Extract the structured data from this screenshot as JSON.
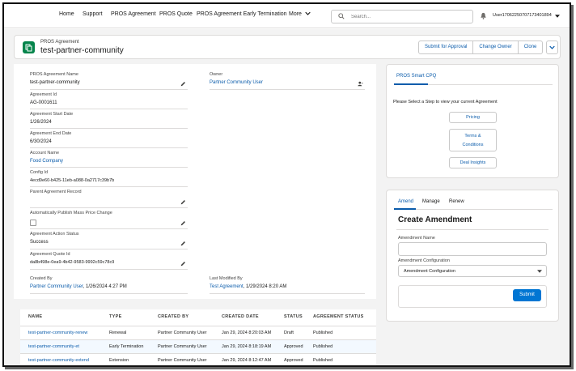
{
  "nav": {
    "items": [
      "Home",
      "Support",
      "PROS Agreement",
      "PROS Quote",
      "PROS Agreement Early Termination"
    ],
    "more_label": "More",
    "search_placeholder": "Search...",
    "user_name": "User17062250707173401894"
  },
  "header": {
    "object_type": "PROS Agreement",
    "record_name": "test-partner-community",
    "buttons": [
      "Submit for Approval",
      "Change Owner",
      "Clone"
    ]
  },
  "details": {
    "agreement_name": {
      "label": "PROS Agreement Name",
      "value": "test-partner-community"
    },
    "owner": {
      "label": "Owner",
      "value": "Partner Community User"
    },
    "agreement_id": {
      "label": "Agreement Id",
      "value": "AG-0001611"
    },
    "start_date": {
      "label": "Agreement Start Date",
      "value": "1/26/2024"
    },
    "end_date": {
      "label": "Agreement End Date",
      "value": "6/30/2024"
    },
    "account_name": {
      "label": "Account Name",
      "value": "Food Company"
    },
    "config_id": {
      "label": "Config Id",
      "value": "4ecd9e60-b425-11eb-a088-0a2717c39b7b"
    },
    "parent_record": {
      "label": "Parent Agreement Record",
      "value": ""
    },
    "auto_publish": {
      "label": "Automatically Publish Mass Price Change",
      "checked": false
    },
    "action_status": {
      "label": "Agreement Action Status",
      "value": "Success"
    },
    "quote_id": {
      "label": "Agreement Quote Id",
      "value": "da8b498e-0ea9-4b42-9583-9992c59c78c9"
    },
    "created_by": {
      "label": "Created By",
      "user": "Partner Community User",
      "date": ", 1/26/2024 4:27 PM"
    },
    "modified_by": {
      "label": "Last Modified By",
      "user": "Test Agreement",
      "date": ", 1/29/2024 8:20 AM"
    }
  },
  "related": {
    "columns": [
      "NAME",
      "TYPE",
      "CREATED BY",
      "CREATED DATE",
      "STATUS",
      "AGREEMENT STATUS"
    ],
    "rows": [
      {
        "name": "test-partner-community-renew",
        "type": "Renewal",
        "created_by": "Partner Community User",
        "created_date": "Jan 29, 2024 8:20:03 AM",
        "status": "Draft",
        "agreement_status": "Published"
      },
      {
        "name": "test-partner-community-et",
        "type": "Early Termination",
        "created_by": "Partner Community User",
        "created_date": "Jan 29, 2024 8:18:19 AM",
        "status": "Approved",
        "agreement_status": "Published"
      },
      {
        "name": "test-partner-community-extend",
        "type": "Extension",
        "created_by": "Partner Community User",
        "created_date": "Jan 29, 2024 8:12:47 AM",
        "status": "Approved",
        "agreement_status": "Published"
      }
    ]
  },
  "cpq": {
    "tab": "PROS Smart CPQ",
    "message": "Please Select a Step to view your current Agreement",
    "buttons": {
      "pricing": "Pricing",
      "terms_1": "Terms &",
      "terms_2": "Conditions",
      "insights": "Deal Insights"
    }
  },
  "amend": {
    "tabs": [
      "Amend",
      "Manage",
      "Renew"
    ],
    "title": "Create Amendment",
    "name_label": "Amendment Name",
    "name_value": "",
    "config_label": "Amendment Configuration",
    "config_value": "Amendment Configuration",
    "submit": "Submit"
  },
  "colors": {
    "accent": "#0176d3",
    "link": "#0b5cab",
    "icon_green": "#04844b"
  }
}
